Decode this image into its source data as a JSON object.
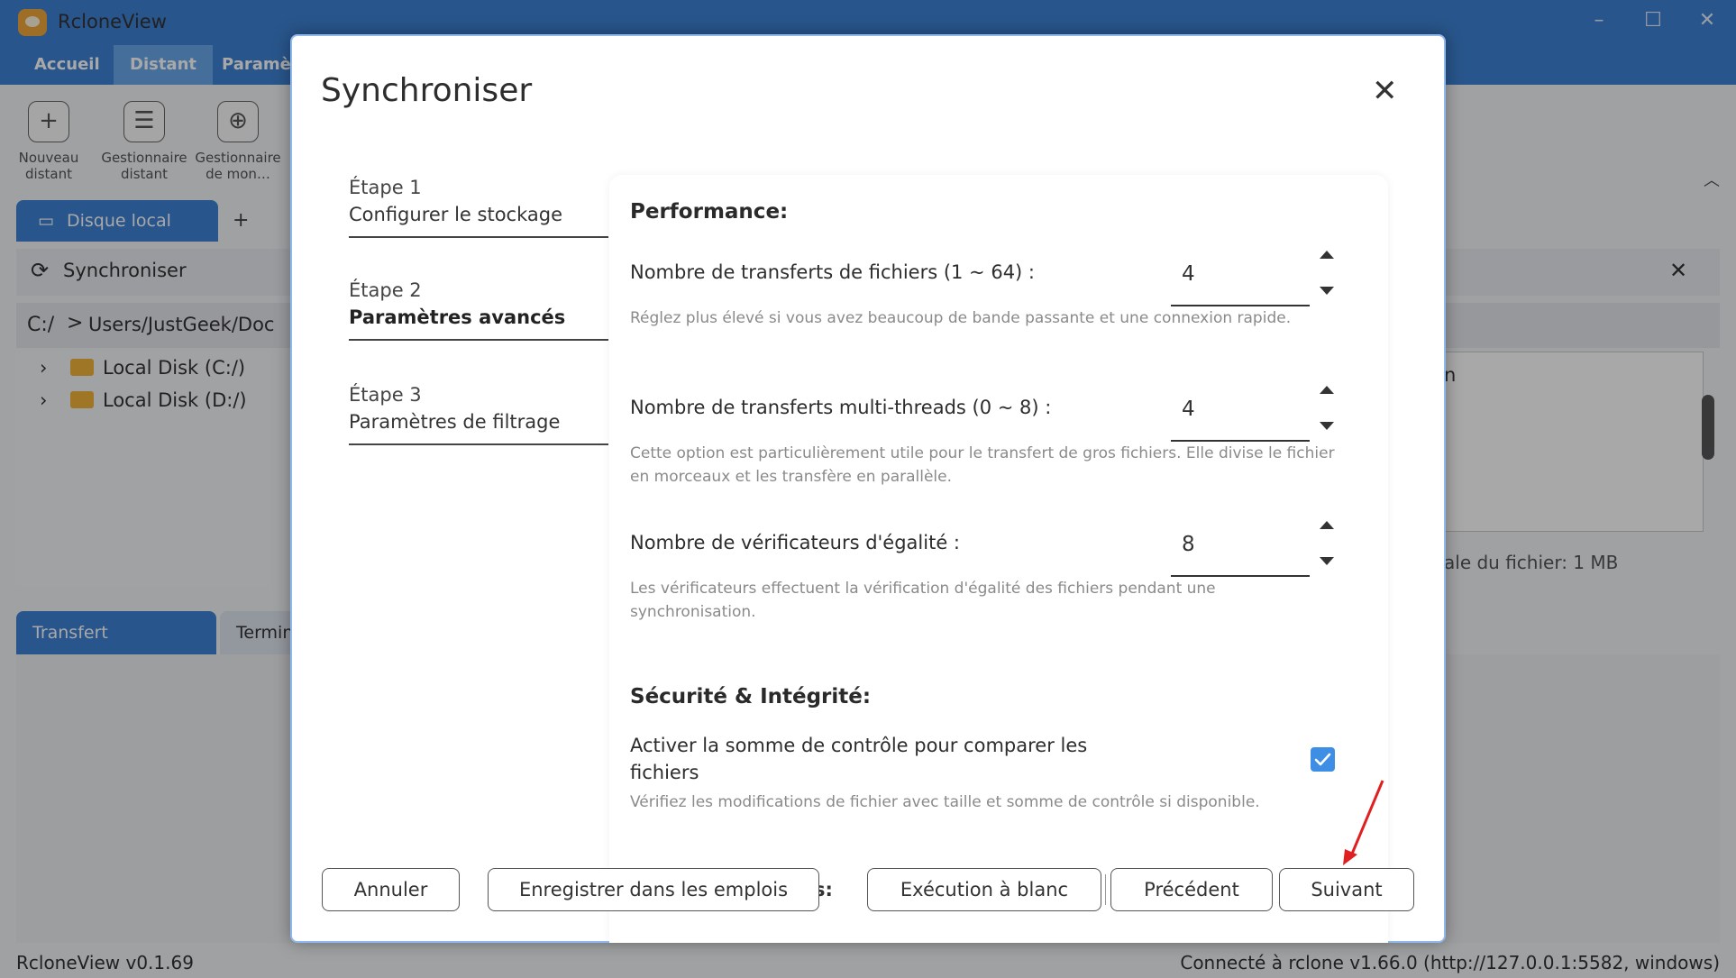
{
  "app": {
    "title": "RcloneView",
    "menu": [
      "Accueil",
      "Distant",
      "Paramè"
    ],
    "toolbar": [
      {
        "icon": "plus-icon",
        "label": "Nouveau distant"
      },
      {
        "icon": "list-icon",
        "label": "Gestionnaire distant"
      },
      {
        "icon": "cloud-add-icon",
        "label": "Gestionnaire de mon…"
      }
    ],
    "local_tab": "Disque local",
    "add_tab": "+",
    "sync_row_label": "Synchroniser",
    "path": {
      "drive": "C:/",
      "separator": ">",
      "text": "Users/JustGeek/Doc"
    },
    "tree": [
      "Local Disk (C:/)",
      "Local Disk (D:/)"
    ],
    "right_header_text": "n",
    "file_size_text": "ale du fichier: 1 MB",
    "bottom_tabs": [
      "Transfert",
      "Termin"
    ],
    "status_left": "RcloneView v0.1.69",
    "status_right": "Connecté à rclone v1.66.0 (http://127.0.0.1:5582, windows)"
  },
  "dialog": {
    "title": "Synchroniser",
    "steps": [
      {
        "num": "Étape 1",
        "name": "Configurer le stockage",
        "active": false
      },
      {
        "num": "Étape 2",
        "name": "Paramètres avancés",
        "active": true
      },
      {
        "num": "Étape 3",
        "name": "Paramètres de filtrage",
        "active": false
      }
    ],
    "sections": {
      "performance": "Performance:",
      "security": "Sécurité & Intégrité:"
    },
    "fields": [
      {
        "label": "Nombre de transferts de fichiers (1 ~ 64) :",
        "value": "4",
        "help": "Réglez plus élevé si vous avez beaucoup de bande passante et une connexion rapide."
      },
      {
        "label": "Nombre de transferts multi-threads (0 ~ 8) :",
        "value": "4",
        "help": "Cette option est particulièrement utile pour le transfert de gros fichiers. Elle divise le fichier en morceaux et les transfère en parallèle."
      },
      {
        "label": "Nombre de vérificateurs d'égalité :",
        "value": "8",
        "help": "Les vérificateurs effectuent la vérification d'égalité des fichiers pendant une synchronisation."
      }
    ],
    "checksum": {
      "label": "Activer la somme de contrôle pour comparer les fichiers",
      "checked": true,
      "help": "Vérifiez les modifications de fichier avec taille et somme de contrôle si disponible."
    },
    "hidden_label": "s:",
    "buttons": {
      "cancel": "Annuler",
      "save": "Enregistrer dans les emplois",
      "dry_run": "Exécution à blanc",
      "previous": "Précédent",
      "next": "Suivant"
    }
  },
  "colors": {
    "accent": "#3e82d4",
    "checkbox": "#3f8ee6",
    "annotation_arrow": "#e02020"
  }
}
